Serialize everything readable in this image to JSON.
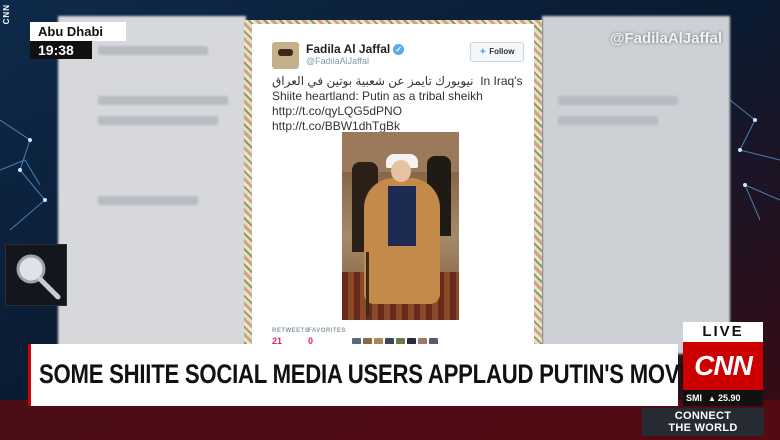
{
  "broadcast": {
    "location": "Abu Dhabi",
    "time": "19:38",
    "side_bug": "CNN",
    "source_handle": "@FadilaAlJaffal"
  },
  "tweet": {
    "display_name": "Fadila Al Jaffal",
    "verified_mark": "✓",
    "username": "@FadilaAlJaffal",
    "follow_label": "Follow",
    "follow_icon": "bird-icon",
    "text_arabic": "نيويورك تايمز عن شعبية بوتين في العراق",
    "text_english": "In Iraq's Shiite heartland: Putin as a tribal sheikh http://t.co/qyLQG5dPNO http://t.co/BBW1dhTgBk",
    "stats": {
      "retweets_label": "RETWEETS",
      "retweets_value": "21",
      "favorites_label": "FAVORITES",
      "favorites_value": "0"
    }
  },
  "headline": "SOME SHIITE SOCIAL MEDIA USERS APPLAUD PUTIN'S MOVES",
  "live_label": "LIVE",
  "logo_text": "CNN",
  "ticker": {
    "symbol": "SMI",
    "direction_icon": "up-triangle-icon",
    "value": "25.90"
  },
  "promo": {
    "line1": "CONNECT",
    "line2": "THE WORLD"
  },
  "colors": {
    "cnn_red": "#cc0000",
    "twitter_blue": "#55acee",
    "stat_pink": "#e0245e"
  }
}
